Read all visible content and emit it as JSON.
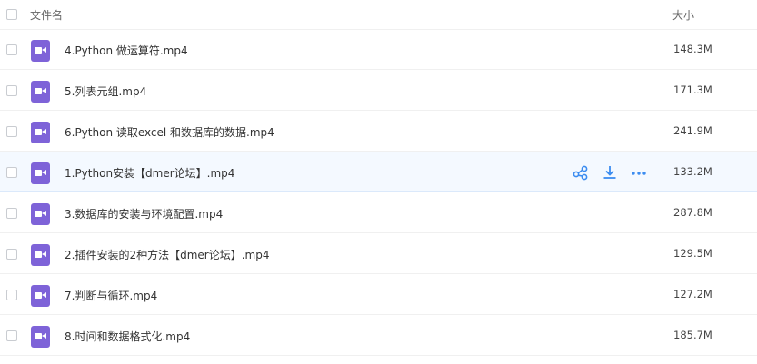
{
  "header": {
    "name_label": "文件名",
    "size_label": "大小"
  },
  "files": [
    {
      "name": "4.Python 做运算符.mp4",
      "size": "148.3M"
    },
    {
      "name": "5.列表元组.mp4",
      "size": "171.3M"
    },
    {
      "name": "6.Python 读取excel 和数据库的数据.mp4",
      "size": "241.9M"
    },
    {
      "name": "1.Python安装【dmer论坛】.mp4",
      "size": "133.2M"
    },
    {
      "name": "3.数据库的安装与环境配置.mp4",
      "size": "287.8M"
    },
    {
      "name": "2.插件安装的2种方法【dmer论坛】.mp4",
      "size": "129.5M"
    },
    {
      "name": "7.判断与循环.mp4",
      "size": "127.2M"
    },
    {
      "name": "8.时间和数据格式化.mp4",
      "size": "185.7M"
    }
  ],
  "hovered_row_index": 3,
  "row_actions": [
    "share-icon",
    "download-icon",
    "more-icon"
  ],
  "colors": {
    "file_icon": "#7e63d8",
    "action_icon": "#3b8cf0",
    "hover_row": "#f4f9ff"
  }
}
